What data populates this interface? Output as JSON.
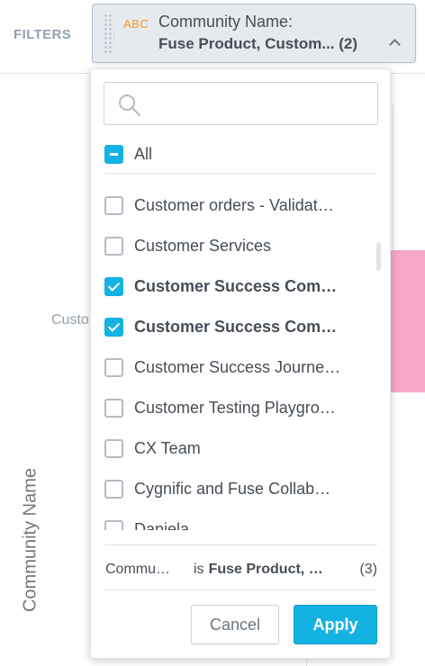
{
  "filter_bar": {
    "label": "FILTERS",
    "chip": {
      "type_badge": "ABC",
      "title": "Community Name:",
      "value": "Fuse Product, Custom... (2)",
      "icon": "chevron-up-icon"
    }
  },
  "background": {
    "tick_label": "Custo",
    "y_axis_label": "Community Name",
    "bar_color": "#f5a8c8"
  },
  "dropdown": {
    "search": {
      "placeholder": "",
      "value": "",
      "icon": "search-icon"
    },
    "all": {
      "label": "All",
      "state": "partial"
    },
    "items": [
      {
        "label": "Customer orders - Validat…",
        "checked": false
      },
      {
        "label": "Customer Services",
        "checked": false
      },
      {
        "label": "Customer Success Com…",
        "checked": true
      },
      {
        "label": "Customer Success Com…",
        "checked": true
      },
      {
        "label": "Customer Success Journe…",
        "checked": false
      },
      {
        "label": "Customer Testing Playgro…",
        "checked": false
      },
      {
        "label": "CX Team",
        "checked": false
      },
      {
        "label": "Cygnific and Fuse Collab…",
        "checked": false
      },
      {
        "label": "Daniela",
        "checked": false
      }
    ],
    "summary": {
      "name": "Commu…",
      "operator": "is",
      "value": "Fuse Product, …",
      "count": "(3)"
    },
    "buttons": {
      "cancel": "Cancel",
      "apply": "Apply"
    }
  },
  "colors": {
    "accent": "#14b2e2",
    "badge": "#fa9634",
    "text": "#464e56"
  }
}
